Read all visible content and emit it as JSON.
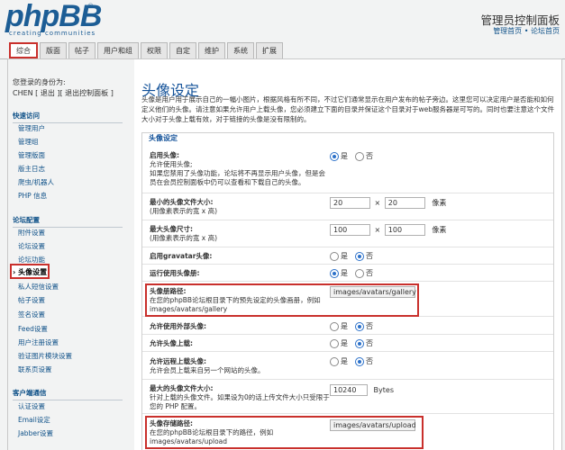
{
  "logo": {
    "text": "phpBB",
    "tagline": "creating communities",
    "trademark": "®"
  },
  "header": {
    "title": "管理员控制面板",
    "link_home": "管理首页",
    "sep": " • ",
    "link_forum": "论坛首页"
  },
  "tabs": [
    "综合",
    "版面",
    "帖子",
    "用户和组",
    "权限",
    "自定",
    "维护",
    "系统",
    "扩展"
  ],
  "login": {
    "label": "您登录的身份为:",
    "line": "CHEN [ 退出 ][ 退出控制面板 ]"
  },
  "sidebar": {
    "sections": [
      {
        "title": "快速访问",
        "items": [
          "管理用户",
          "管理组",
          "管理版面",
          "版主日志",
          "爬虫/机器人",
          "PHP 信息"
        ]
      },
      {
        "title": "论坛配置",
        "items": [
          "附件设置",
          "论坛设置",
          "论坛功能",
          "头像设置",
          "私人短信设置",
          "帖子设置",
          "签名设置",
          "Feed设置",
          "用户注册设置",
          "验证图片模块设置",
          "联系页设置"
        ]
      },
      {
        "title": "客户端通信",
        "items": [
          "认证设置",
          "Email设定",
          "Jabber设置"
        ]
      }
    ]
  },
  "main": {
    "title": "头像设定",
    "intro": "头像是用户用于展示自己的一幅小图片，根据风格有所不同，不过它们通常显示在用户发布的帖子旁边。这里您可以决定用户是否能和如何定义他们的头像。请注意如果允许用户上载头像，您必须建立下面的目录并保证这个目录对于web服务器是可写的。同时也要注意这个文件大小对于头像上载有效，对于链接的头像是没有限制的。",
    "legend": "头像设定",
    "yes": "是",
    "no": "否",
    "times": "×",
    "px": "像素",
    "bytes": "Bytes",
    "rows": [
      {
        "label": "启用头像:",
        "desc": "允许使用头像;\n如果您禁用了头像功能，论坛将不再显示用户头像，但是会员在会员控制面板中仍可以查看和下载自己的头像。",
        "control": "radio",
        "value": "是"
      },
      {
        "label": "最小的头像文件大小:",
        "desc": "(用像素表示的宽 x 高)",
        "control": "dims",
        "w": "20",
        "h": "20"
      },
      {
        "label": "最大头像尺寸:",
        "desc": "(用像素表示的宽 x 高)",
        "control": "dims",
        "w": "100",
        "h": "100"
      },
      {
        "label": "启用gravatar头像:",
        "desc": "",
        "control": "radio",
        "value": "否"
      },
      {
        "label": "运行使用头像册:",
        "desc": "",
        "control": "radio",
        "value": "是"
      },
      {
        "label": "头像册路径:",
        "desc": "在您的phpBB论坛根目录下的预先设定的头像画册，例如 images/avatars/gallery",
        "control": "text",
        "value": "images/avatars/gallery"
      },
      {
        "label": "允许使用外部头像:",
        "desc": "",
        "control": "radio",
        "value": "否"
      },
      {
        "label": "允许头像上载:",
        "desc": "",
        "control": "radio",
        "value": "否"
      },
      {
        "label": "允许远程上载头像:",
        "desc": "允许会员上载来自另一个网站的头像。",
        "control": "radio",
        "value": "否"
      },
      {
        "label": "最大的头像文件大小:",
        "desc": "针对上载的头像文件。如果设为0的话上传文件大小只受限于您的 PHP 配置。",
        "control": "bytes",
        "value": "10240"
      },
      {
        "label": "头像存储路径:",
        "desc": "在您的phpBB论坛根目录下的路径，例如 images/avatars/upload",
        "control": "text",
        "value": "images/avatars/upload"
      }
    ]
  },
  "colors": {
    "accent": "#c9302c",
    "brand": "#105289",
    "title": "#115098"
  }
}
